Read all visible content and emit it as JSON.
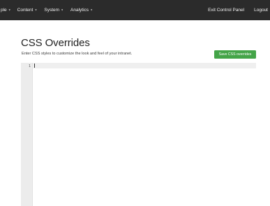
{
  "nav": {
    "items": [
      {
        "label": "ple",
        "has_caret": true
      },
      {
        "label": "Content",
        "has_caret": true
      },
      {
        "label": "System",
        "has_caret": true
      },
      {
        "label": "Analytics",
        "has_caret": true
      }
    ],
    "exit_label": "Exit Control Panel",
    "logout_label": "Logout"
  },
  "page": {
    "title": "CSS Overrides",
    "description": "Enter CSS styles to customize the look and feel of your intranet.",
    "save_label": "Save CSS overrides"
  },
  "editor": {
    "line_numbers": [
      "1"
    ],
    "content": ""
  },
  "colors": {
    "topbar": "#2b2b2b",
    "save_button": "#44a448",
    "gutter": "#ececec"
  },
  "icons": {
    "dropdown": "chevron-down-icon"
  }
}
